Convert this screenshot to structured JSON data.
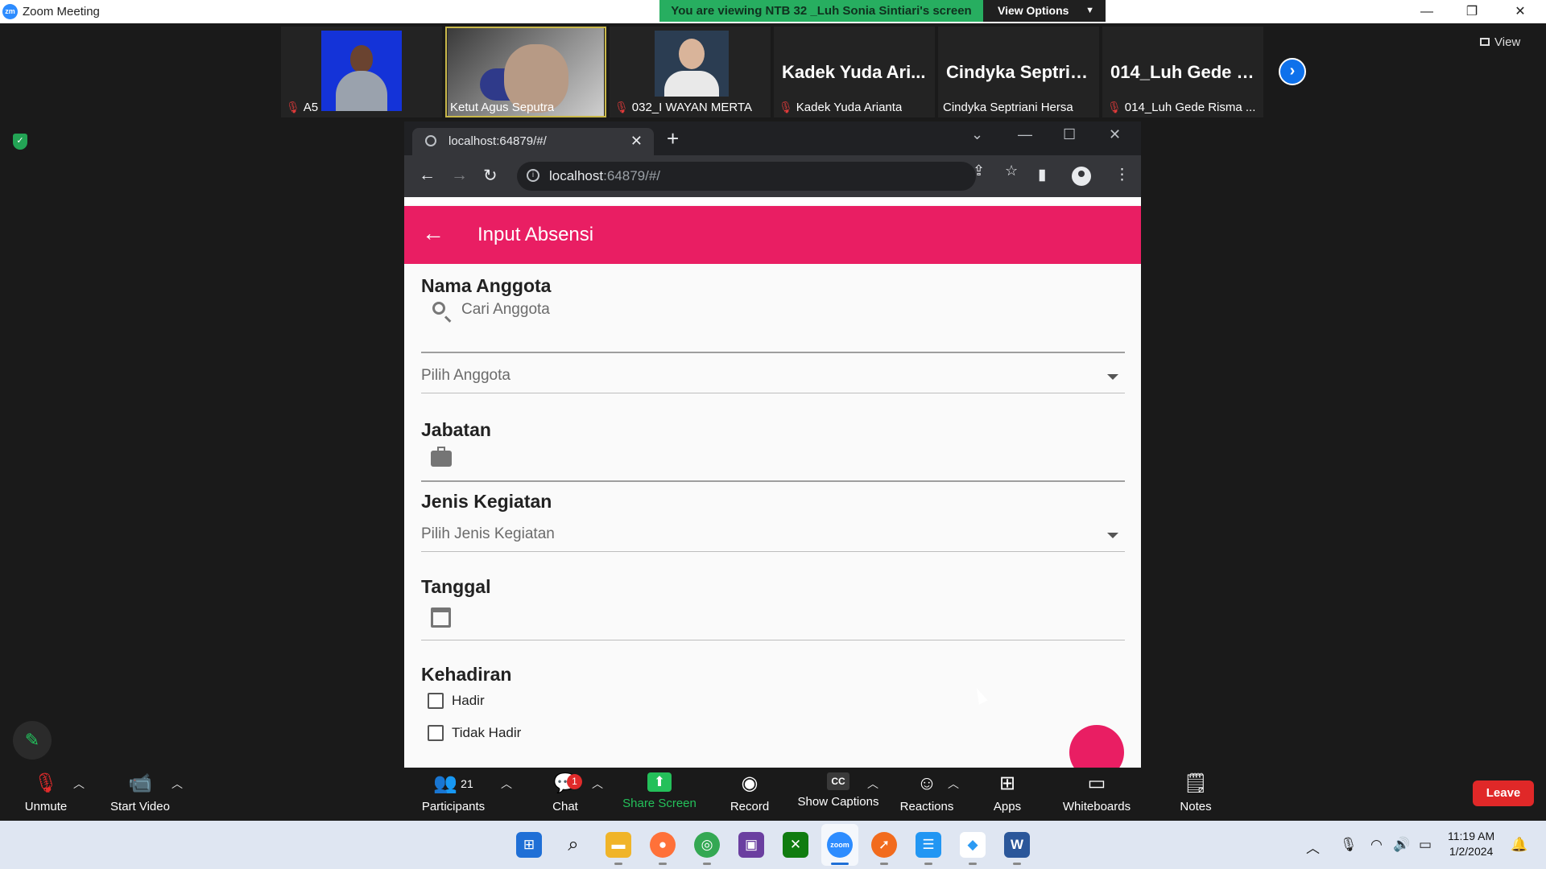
{
  "window": {
    "app_title": "Zoom Meeting",
    "min": "—",
    "restore": "❐",
    "close": "✕"
  },
  "banner": {
    "viewing_text": "You are viewing NTB 32 _Luh Sonia Sintiari's screen",
    "view_options_label": "View Options"
  },
  "gallery": {
    "tiles": [
      {
        "big_name": "",
        "label": "A5",
        "muted": true
      },
      {
        "big_name": "",
        "label": "Ketut Agus Seputra",
        "muted": false
      },
      {
        "big_name": "",
        "label": "032_I WAYAN MERTA",
        "muted": true
      },
      {
        "big_name": "Kadek Yuda Ari...",
        "label": "Kadek Yuda Arianta",
        "muted": true
      },
      {
        "big_name": "Cindyka Septria...",
        "label": "Cindyka Septriani Hersa",
        "muted": false
      },
      {
        "big_name": "014_Luh Gede R...",
        "label": "014_Luh Gede Risma ...",
        "muted": true
      }
    ],
    "view_label": "View"
  },
  "browser": {
    "tab_title": "localhost:64879/#/",
    "url_host": "localhost",
    "url_path": ":64879/#/"
  },
  "app": {
    "title": "Input Absensi",
    "nama_anggota_label": "Nama Anggota",
    "search_placeholder": "Cari Anggota",
    "pilih_anggota": "Pilih Anggota",
    "jabatan_label": "Jabatan",
    "jenis_kegiatan_label": "Jenis Kegiatan",
    "pilih_jenis_kegiatan": "Pilih Jenis Kegiatan",
    "tanggal_label": "Tanggal",
    "kehadiran_label": "Kehadiran",
    "option_hadir": "Hadir",
    "option_tidak_hadir": "Tidak Hadir",
    "accent_color": "#e91e63"
  },
  "toolbar": {
    "unmute": "Unmute",
    "start_video": "Start Video",
    "participants": "Participants",
    "participants_count": "21",
    "chat": "Chat",
    "chat_badge": "1",
    "share_screen": "Share Screen",
    "record": "Record",
    "show_captions": "Show Captions",
    "cc_icon_text": "CC",
    "reactions": "Reactions",
    "apps": "Apps",
    "whiteboards": "Whiteboards",
    "notes": "Notes",
    "leave": "Leave",
    "share_color": "#24c05a",
    "leave_color": "#e02828"
  },
  "taskbar": {
    "time": "11:19 AM",
    "date": "1/2/2024",
    "zoom_icon_text": "zoom",
    "word_icon_text": "W"
  }
}
